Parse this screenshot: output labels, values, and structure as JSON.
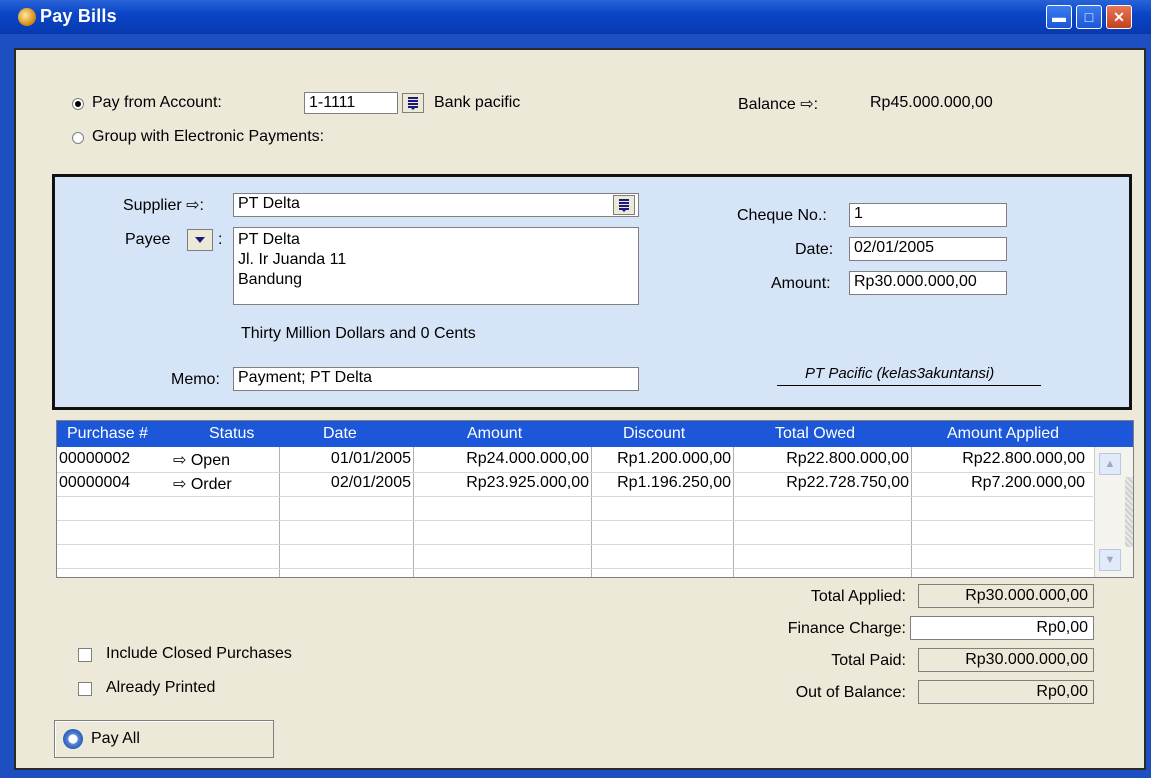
{
  "window": {
    "title": "Pay Bills",
    "controls": [
      "minimize",
      "maximize",
      "close"
    ]
  },
  "pay_from": {
    "option_account_label": "Pay from Account:",
    "option_group_label": "Group with Electronic Payments:",
    "selected_option": "account",
    "account_number": "1-1111",
    "account_name": "Bank pacific",
    "balance_label": "Balance ⇨:",
    "balance_value": "Rp45.000.000,00"
  },
  "cheque": {
    "supplier_label": "Supplier ⇨:",
    "supplier_value": "PT Delta",
    "payee_label": "Payee",
    "payee_colon": ":",
    "payee_lines": [
      "PT Delta",
      "Jl. Ir Juanda 11",
      "Bandung"
    ],
    "amount_words": "Thirty Million Dollars and 0 Cents",
    "memo_label": "Memo:",
    "memo_value": "Payment; PT Delta",
    "cheque_no_label": "Cheque No.:",
    "cheque_no_value": "1",
    "date_label": "Date:",
    "date_value": "02/01/2005",
    "amount_label": "Amount:",
    "amount_value": "Rp30.000.000,00",
    "signature": "PT Pacific (kelas3akuntansi)"
  },
  "table": {
    "columns": [
      "Purchase #",
      "Status",
      "Date",
      "Amount",
      "Discount",
      "Total Owed",
      "Amount Applied"
    ],
    "rows": [
      {
        "purchase": "00000002",
        "status": "⇨ Open",
        "date": "01/01/2005",
        "amount": "Rp24.000.000,00",
        "discount": "Rp1.200.000,00",
        "total_owed": "Rp22.800.000,00",
        "applied": "Rp22.800.000,00"
      },
      {
        "purchase": "00000004",
        "status": "⇨ Order",
        "date": "02/01/2005",
        "amount": "Rp23.925.000,00",
        "discount": "Rp1.196.250,00",
        "total_owed": "Rp22.728.750,00",
        "applied": "Rp7.200.000,00"
      }
    ]
  },
  "totals": {
    "total_applied_label": "Total Applied:",
    "total_applied": "Rp30.000.000,00",
    "finance_charge_label": "Finance Charge:",
    "finance_charge": "Rp0,00",
    "total_paid_label": "Total Paid:",
    "total_paid": "Rp30.000.000,00",
    "out_of_balance_label": "Out of Balance:",
    "out_of_balance": "Rp0,00"
  },
  "options": {
    "include_closed_label": "Include Closed Purchases",
    "include_closed_checked": false,
    "already_printed_label": "Already Printed",
    "already_printed_checked": false
  },
  "buttons": {
    "pay_all": "Pay All"
  }
}
